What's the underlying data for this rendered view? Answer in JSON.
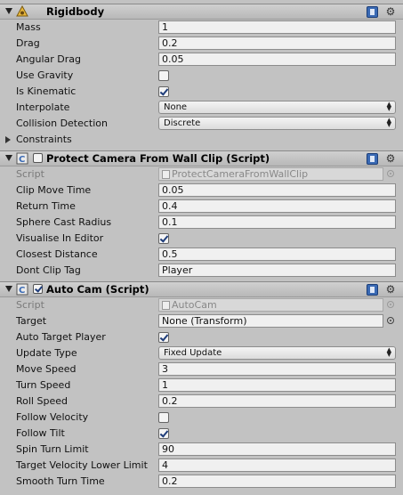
{
  "rigidbody": {
    "title": "Rigidbody",
    "icon": "rigidbody-icon",
    "fields": [
      {
        "label": "Mass",
        "value": "1"
      },
      {
        "label": "Drag",
        "value": "0.2"
      },
      {
        "label": "Angular Drag",
        "value": "0.05"
      }
    ],
    "use_gravity_label": "Use Gravity",
    "use_gravity": false,
    "is_kinematic_label": "Is Kinematic",
    "is_kinematic": true,
    "interpolate_label": "Interpolate",
    "interpolate_value": "None",
    "collision_label": "Collision Detection",
    "collision_value": "Discrete",
    "constraints_label": "Constraints"
  },
  "protect": {
    "title": "Protect Camera From Wall Clip (Script)",
    "enabled": false,
    "script_label": "Script",
    "script_value": "ProtectCameraFromWallClip",
    "fields": [
      {
        "label": "Clip Move Time",
        "value": "0.05"
      },
      {
        "label": "Return Time",
        "value": "0.4"
      },
      {
        "label": "Sphere Cast Radius",
        "value": "0.1"
      }
    ],
    "visualise_label": "Visualise In Editor",
    "visualise": true,
    "closest_label": "Closest Distance",
    "closest_value": "0.5",
    "dont_clip_label": "Dont Clip Tag",
    "dont_clip_value": "Player"
  },
  "autocam": {
    "title": "Auto Cam (Script)",
    "enabled": true,
    "script_label": "Script",
    "script_value": "AutoCam",
    "target_label": "Target",
    "target_value": "None (Transform)",
    "auto_target_label": "Auto Target Player",
    "auto_target": true,
    "update_type_label": "Update Type",
    "update_type_value": "Fixed Update",
    "move_speed_label": "Move Speed",
    "move_speed_value": "3",
    "turn_speed_label": "Turn Speed",
    "turn_speed_value": "1",
    "roll_speed_label": "Roll Speed",
    "roll_speed_value": "0.2",
    "follow_velocity_label": "Follow Velocity",
    "follow_velocity": false,
    "follow_tilt_label": "Follow Tilt",
    "follow_tilt": true,
    "spin_turn_label": "Spin Turn Limit",
    "spin_turn_value": "90",
    "target_vel_label": "Target Velocity Lower Limit",
    "target_vel_value": "4",
    "smooth_turn_label": "Smooth Turn Time",
    "smooth_turn_value": "0.2"
  },
  "icons": {
    "help": "help-book-icon",
    "settings": "gear-icon",
    "script": "script-icon"
  }
}
